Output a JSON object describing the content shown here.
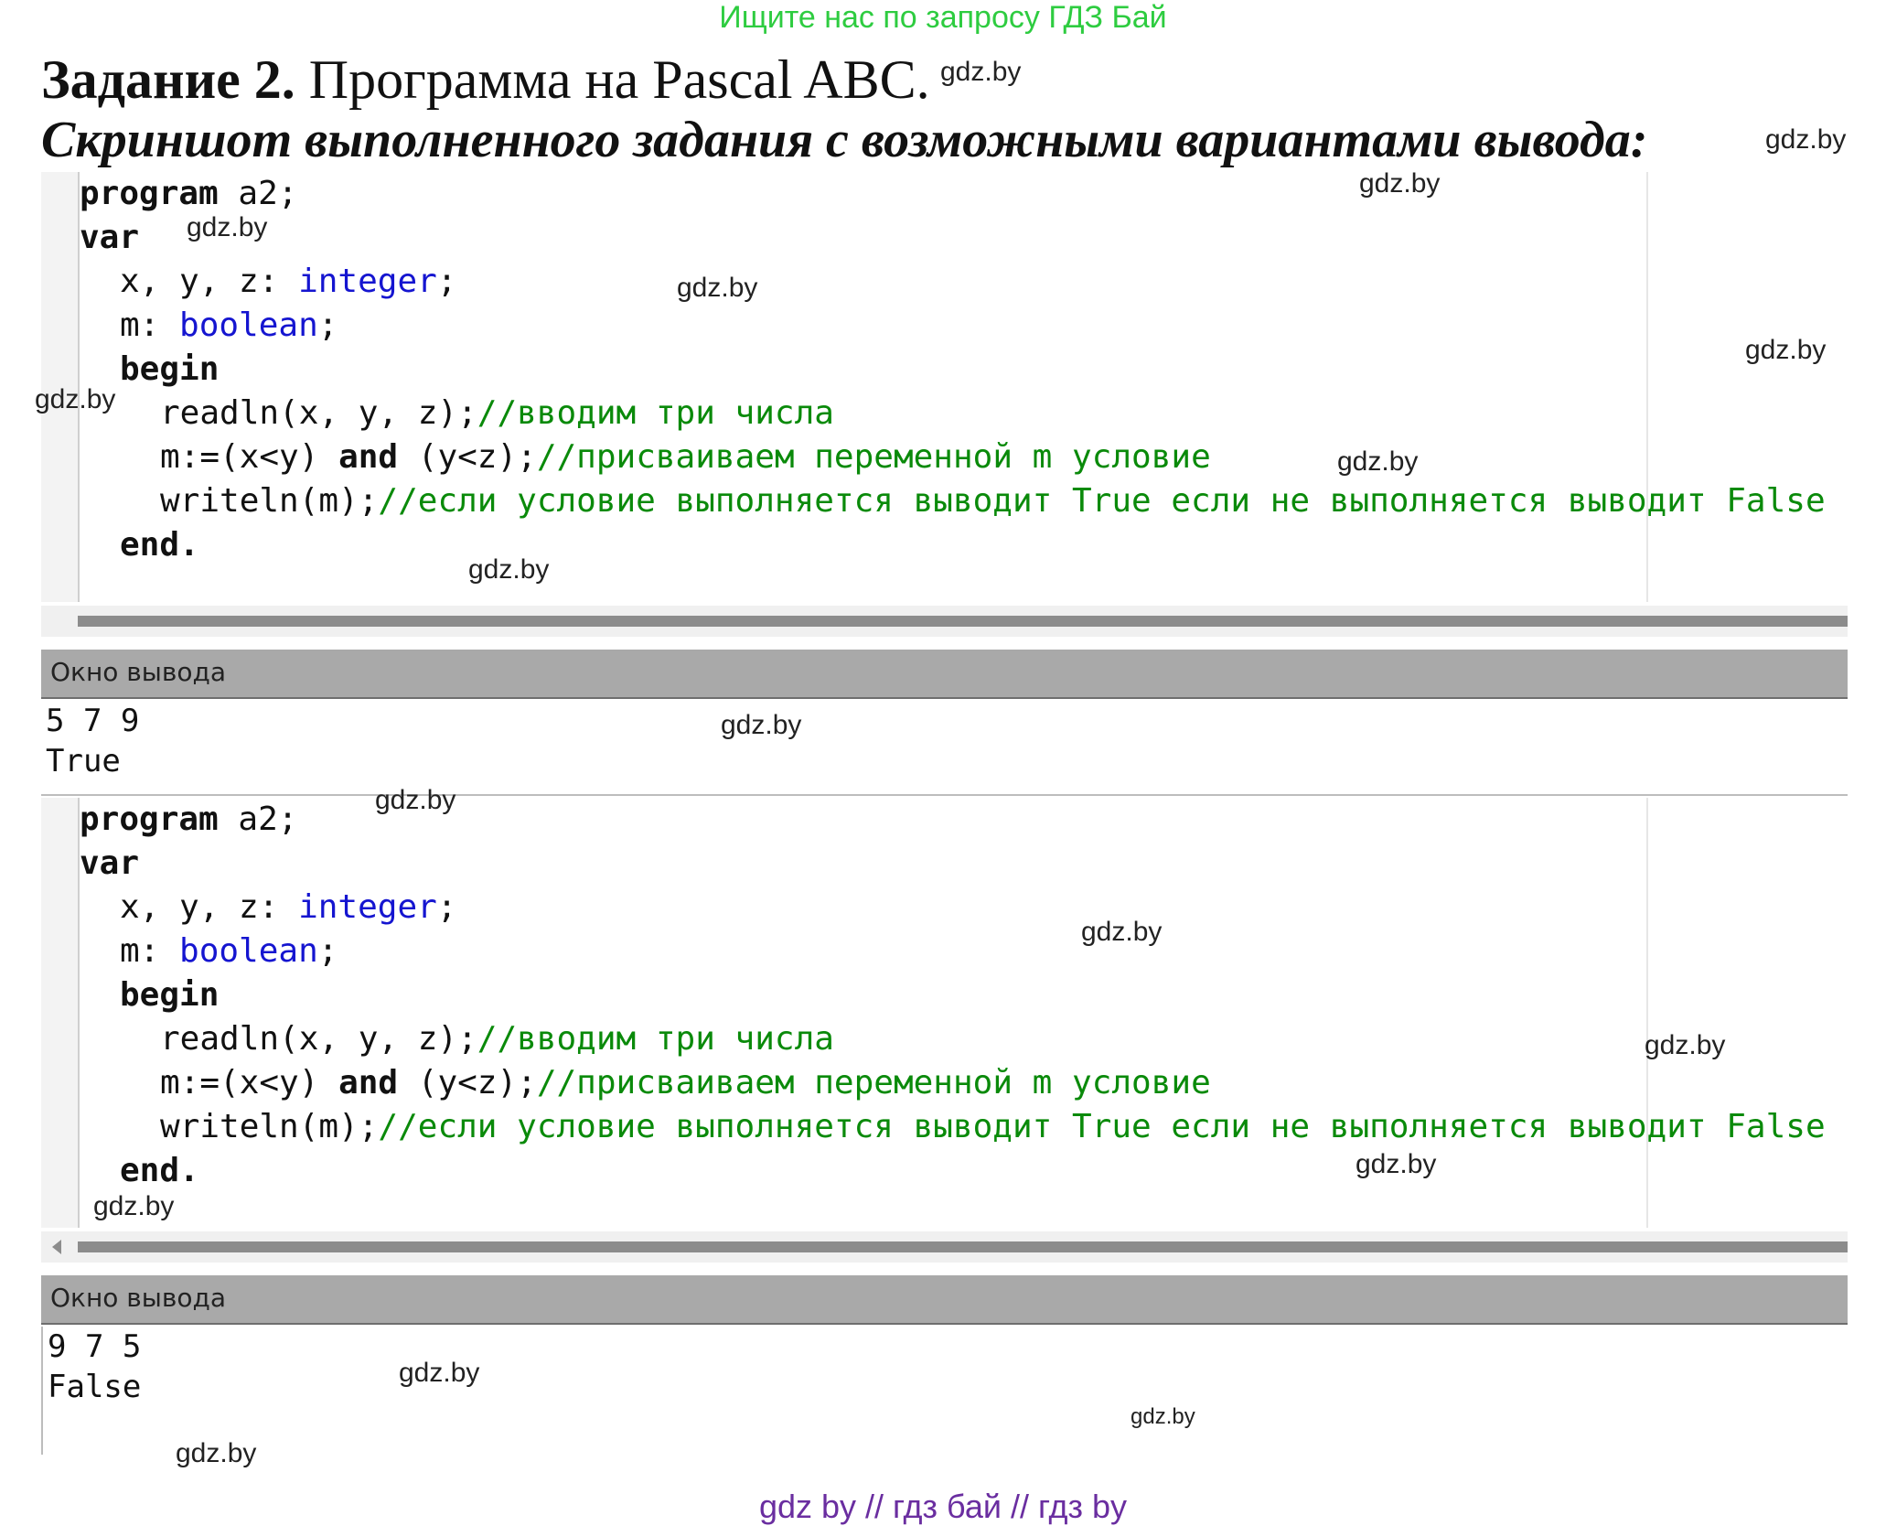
{
  "banner": "Ищите нас по запросу ГДЗ Бай",
  "title": {
    "bold": "Задание 2.",
    "rest": " Программа на Pascal ABC."
  },
  "subtitle": "Скриншот выполненного задания с возможными вариантами вывода:",
  "watermark": "gdz.by",
  "program": {
    "line1_kw": "program",
    "line1_rest": " a2;",
    "line2_kw": "var",
    "line3_vars": "x, y, z: ",
    "line3_type": "integer",
    "line3_end": ";",
    "line4_var": "m: ",
    "line4_type": "boolean",
    "line4_end": ";",
    "line5_kw": "begin",
    "line6_code": "readln(x, y, z);",
    "line6_comment": "//вводим три числа",
    "line7_code_a": "m:=(x<y) ",
    "line7_kw": "and",
    "line7_code_b": " (y<z);",
    "line7_comment": "//присваиваем переменной m условие",
    "line8_code": "writeln(m);",
    "line8_comment": "//если условие выполняется выводит True если не выполняется выводит False",
    "line9_kw": "end."
  },
  "output_header": "Окно вывода",
  "output1": [
    "5 7 9",
    "True"
  ],
  "output2": [
    "9 7 5",
    "False"
  ],
  "footer": "gdz by  //  гдз бай  //  гдз by"
}
